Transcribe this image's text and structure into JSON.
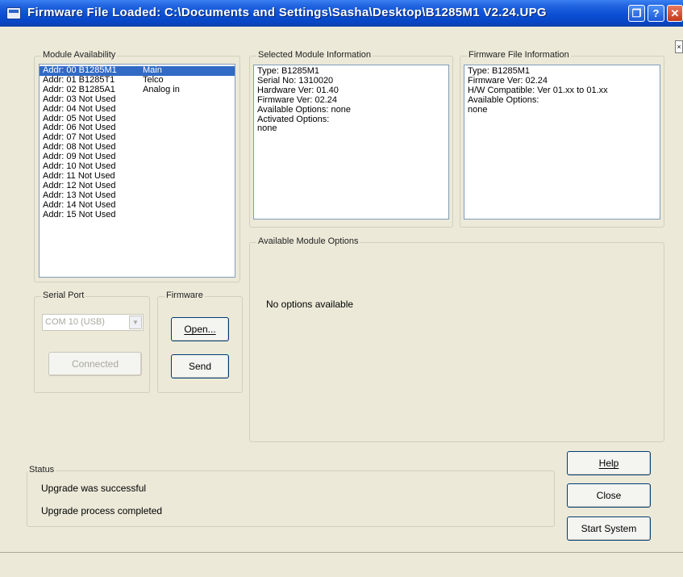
{
  "window": {
    "title": "Firmware File Loaded: C:\\Documents and Settings\\Sasha\\Desktop\\B1285M1 V2.24.UPG",
    "restore_symbol": "❐",
    "help_symbol": "?",
    "close_symbol": "✕",
    "side_tab_symbol": "×"
  },
  "module_availability": {
    "title": "Module Availability",
    "rows": [
      {
        "addr": "Addr: 00  B1285M1",
        "role": "Main",
        "selected": true
      },
      {
        "addr": "Addr: 01  B1285T1",
        "role": "Telco"
      },
      {
        "addr": "Addr: 02  B1285A1",
        "role": "Analog in"
      },
      {
        "addr": "Addr: 03 Not Used",
        "role": ""
      },
      {
        "addr": "Addr: 04 Not Used",
        "role": ""
      },
      {
        "addr": "Addr: 05 Not Used",
        "role": ""
      },
      {
        "addr": "Addr: 06 Not Used",
        "role": ""
      },
      {
        "addr": "Addr: 07 Not Used",
        "role": ""
      },
      {
        "addr": "Addr: 08 Not Used",
        "role": ""
      },
      {
        "addr": "Addr: 09 Not Used",
        "role": ""
      },
      {
        "addr": "Addr: 10 Not Used",
        "role": ""
      },
      {
        "addr": "Addr: 11 Not Used",
        "role": ""
      },
      {
        "addr": "Addr: 12 Not Used",
        "role": ""
      },
      {
        "addr": "Addr: 13 Not Used",
        "role": ""
      },
      {
        "addr": "Addr: 14 Not Used",
        "role": ""
      },
      {
        "addr": "Addr: 15 Not Used",
        "role": ""
      }
    ]
  },
  "selected_module": {
    "title": "Selected Module Information",
    "lines": [
      "Type: B1285M1",
      "Serial No: 1310020",
      "Hardware Ver: 01.40",
      "Firmware Ver: 02.24",
      "Available Options: none",
      "Activated Options:",
      "none"
    ]
  },
  "firmware_file": {
    "title": "Firmware File Information",
    "lines": [
      "Type: B1285M1",
      "Firmware Ver: 02.24",
      "H/W Compatible: Ver 01.xx to 01.xx",
      "Available Options:",
      "none"
    ]
  },
  "available_options": {
    "title": "Available Module Options",
    "message": "No options available"
  },
  "serial_port": {
    "title": "Serial Port",
    "port_value": "COM 10 (USB)",
    "dropdown_arrow": "▼",
    "connect_label": "Connected"
  },
  "firmware": {
    "title": "Firmware",
    "open_label": "Open...",
    "send_label": "Send"
  },
  "status": {
    "title": "Status",
    "line1": "Upgrade was successful",
    "line2": "Upgrade process completed"
  },
  "buttons": {
    "help": "Help",
    "close": "Close",
    "start_system": "Start System"
  }
}
